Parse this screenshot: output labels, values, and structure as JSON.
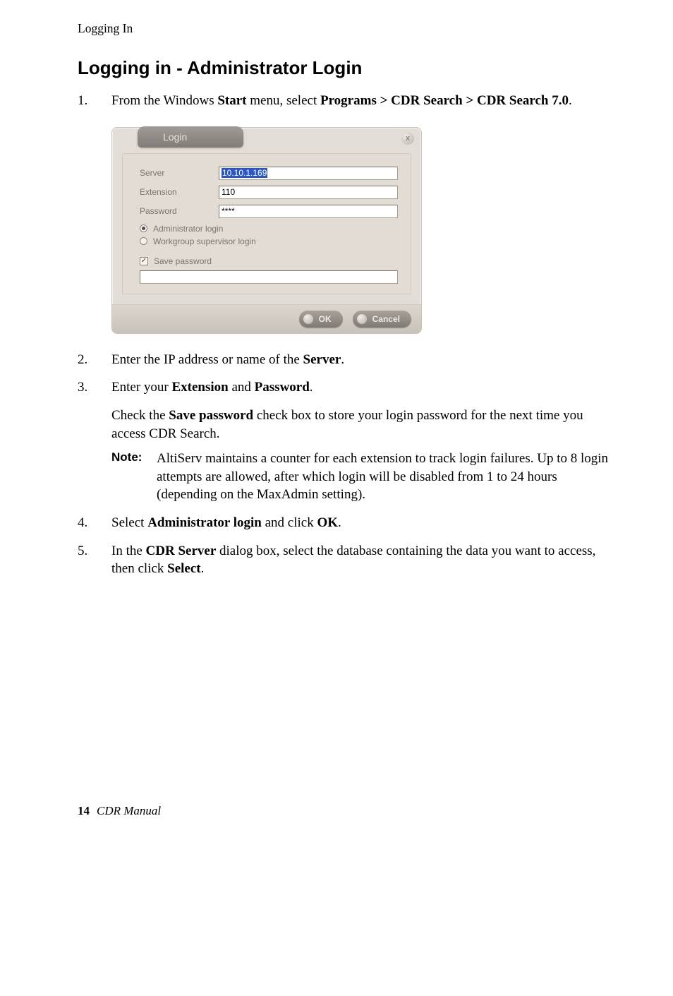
{
  "running_head": "Logging In",
  "section_title": "Logging in - Administrator Login",
  "step1": {
    "num": "1.",
    "pre": "From the Windows ",
    "bold1": "Start",
    "mid": " menu, select ",
    "bold2": "Programs > CDR Search > CDR Search 7.0",
    "end": "."
  },
  "login": {
    "tab": "Login",
    "close": "x",
    "server_label": "Server",
    "server_value": "10.10.1.169",
    "ext_label": "Extension",
    "ext_value": "110",
    "pwd_label": "Password",
    "pwd_value": "****",
    "radio_admin": "Administrator login",
    "radio_wg": "Workgroup supervisor login",
    "save_pwd": "Save password",
    "check_mark": "✓",
    "ok": "OK",
    "cancel": "Cancel"
  },
  "step2": {
    "num": "2.",
    "pre": "Enter the IP address or name of the ",
    "bold": "Server",
    "end": "."
  },
  "step3": {
    "num": "3.",
    "pre": "Enter your ",
    "bold1": "Extension",
    "mid": " and ",
    "bold2": "Password",
    "end": "."
  },
  "step3_sub": {
    "pre": "Check the ",
    "bold": "Save password",
    "rest": " check box to store your login password for the next time you access CDR Search."
  },
  "note": {
    "label": "Note:",
    "text": "AltiServ maintains a counter for each extension to track login failures. Up to 8 login attempts are allowed, after which login will be disabled from 1 to 24 hours (depending on the MaxAdmin setting)."
  },
  "step4": {
    "num": "4.",
    "pre": "Select ",
    "bold1": "Administrator login",
    "mid": " and click ",
    "bold2": "OK",
    "end": "."
  },
  "step5": {
    "num": "5.",
    "pre": "In the ",
    "bold1": "CDR Server",
    "mid": " dialog box, select the database containing the data you want to access, then click ",
    "bold2": "Select",
    "end": "."
  },
  "footer": {
    "page": "14",
    "title": "CDR Manual"
  }
}
